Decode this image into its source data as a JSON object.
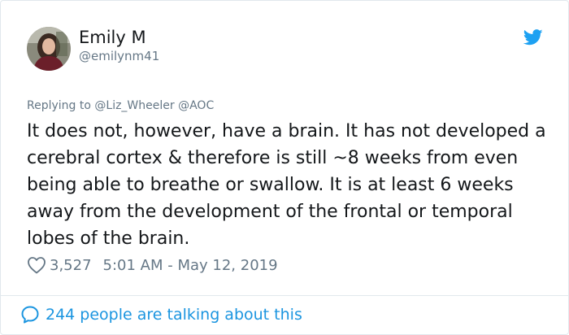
{
  "user": {
    "name": "Emily M",
    "handle": "@emilynm41"
  },
  "reply": {
    "prefix": "Replying to",
    "mentions": [
      "@Liz_Wheeler",
      "@AOC"
    ]
  },
  "tweet": {
    "text": "It does not, however, have a brain. It has not developed a cerebral cortex & therefore is still ~8 weeks from even being able to breathe or swallow. It is at least 6 weeks away from the development of the frontal or temporal lobes of the brain.",
    "likes": "3,527",
    "timestamp": "5:01 AM - May 12, 2019"
  },
  "footer": {
    "talking_label": "244 people are talking about this"
  },
  "icons": {
    "bird": "twitter-bird-icon",
    "heart": "heart-outline-icon",
    "bubble": "comment-bubble-icon"
  },
  "colors": {
    "accent": "#1da1f2",
    "link": "#1b95e0",
    "secondary_text": "#657786",
    "primary_text": "#14171a",
    "border": "#e1e8ed"
  }
}
